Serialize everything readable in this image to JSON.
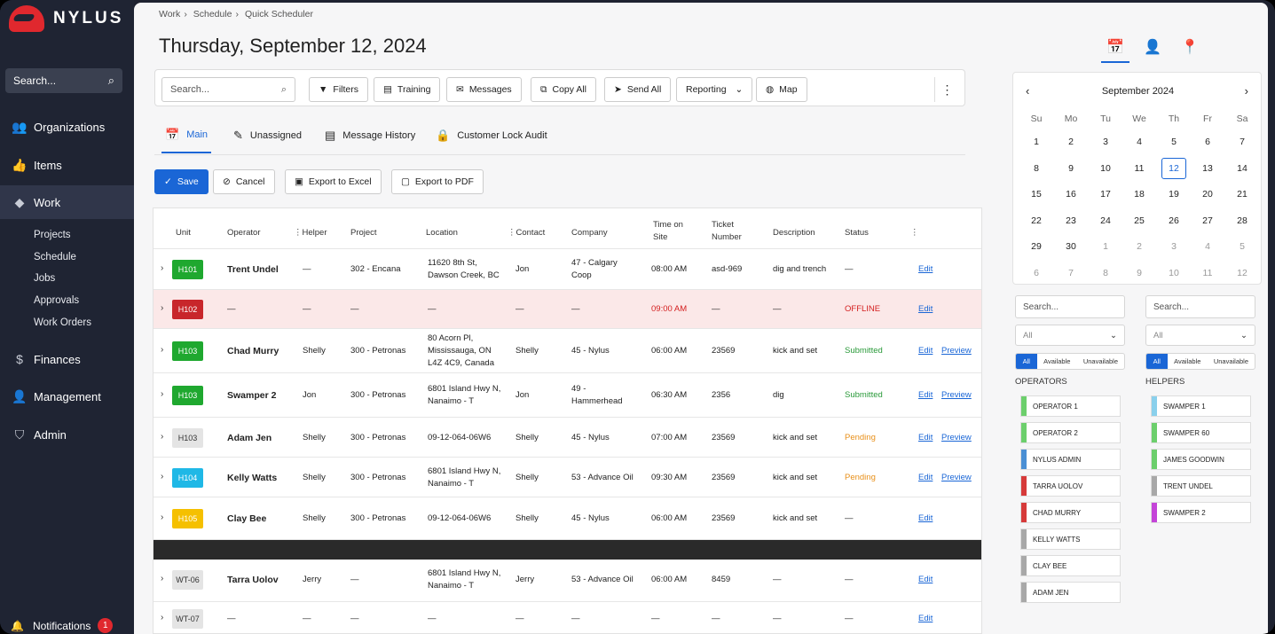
{
  "brand": {
    "name": "NYLUS"
  },
  "sidebar": {
    "search": "Search...",
    "nav": [
      {
        "label": "Organizations",
        "icon": "people-icon"
      },
      {
        "label": "Items",
        "icon": "thumb-icon"
      },
      {
        "label": "Work",
        "icon": "work-icon"
      },
      {
        "label": "Finances",
        "icon": "dollar-icon"
      },
      {
        "label": "Management",
        "icon": "person-icon"
      },
      {
        "label": "Admin",
        "icon": "shield-icon"
      }
    ],
    "sub": [
      "Projects",
      "Schedule",
      "Jobs",
      "Approvals",
      "Work Orders"
    ],
    "notifications": {
      "label": "Notifications",
      "count": "1"
    }
  },
  "breadcrumb": [
    "Work",
    "Schedule",
    "Quick Scheduler"
  ],
  "page_title": "Thursday, September 12, 2024",
  "toolbar": {
    "search": "Search...",
    "buttons": [
      "Filters",
      "Training",
      "Messages",
      "Copy All",
      "Send All",
      "Reporting",
      "Map"
    ]
  },
  "tabs": [
    "Main",
    "Unassigned",
    "Message History",
    "Customer Lock Audit"
  ],
  "actions": [
    "Save",
    "Cancel",
    "Export to Excel",
    "Export to PDF"
  ],
  "table": {
    "headers": {
      "unit": "Unit",
      "operator": "Operator",
      "helper": "Helper",
      "project": "Project",
      "location": "Location",
      "contact": "Contact",
      "company": "Company",
      "time1": "Time on",
      "time2": "Site",
      "ticket1": "Ticket",
      "ticket2": "Number",
      "description": "Description",
      "status": "Status"
    },
    "rows": [
      {
        "unit": "H101",
        "unit_color": "#1fa82f",
        "operator": "Trent Undel",
        "helper": "—",
        "project": "302 - Encana",
        "location": [
          "11620 8th St,",
          "Dawson Creek, BC"
        ],
        "contact": "Jon",
        "company": [
          "47 - Calgary",
          "Coop"
        ],
        "time": "08:00 AM",
        "ticket": "asd-969",
        "description": "dig and trench",
        "status": "—",
        "status_color": "#222",
        "edit": "Edit",
        "preview": ""
      },
      {
        "unit": "H102",
        "unit_color": "#c8262b",
        "operator": "—",
        "helper": "—",
        "project": "—",
        "location": [
          "—"
        ],
        "contact": "—",
        "company": [
          "—"
        ],
        "time": "09:00 AM",
        "ticket": "—",
        "description": "—",
        "status": "OFFLINE",
        "status_color": "#d42020",
        "edit": "Edit",
        "preview": ""
      },
      {
        "unit": "H103",
        "unit_color": "#1fa82f",
        "operator": "Chad Murry",
        "helper": "Shelly",
        "project": "300 - Petronas",
        "location": [
          "80 Acorn Pl,",
          "Mississauga, ON",
          "L4Z 4C9, Canada"
        ],
        "contact": "Shelly",
        "company": [
          "45 - Nylus"
        ],
        "time": "06:00 AM",
        "ticket": "23569",
        "description": "kick and set",
        "status": "Submitted",
        "status_color": "#2a9a3a",
        "edit": "Edit",
        "preview": "Preview"
      },
      {
        "unit": "H103",
        "unit_color": "#1fa82f",
        "operator": "Swamper 2",
        "helper": "Jon",
        "project": "300 - Petronas",
        "location": [
          "6801 Island Hwy N,",
          "Nanaimo - T"
        ],
        "contact": "Jon",
        "company": [
          "49 -",
          "Hammerhead"
        ],
        "time": "06:30 AM",
        "ticket": "2356",
        "description": "dig",
        "status": "Submitted",
        "status_color": "#2a9a3a",
        "edit": "Edit",
        "preview": "Preview"
      },
      {
        "unit": "H103",
        "unit_color": "#e4e4e4",
        "operator": "Adam Jen",
        "helper": "Shelly",
        "project": "300 - Petronas",
        "location": [
          "09-12-064-06W6"
        ],
        "contact": "Shelly",
        "company": [
          "45 - Nylus"
        ],
        "time": "07:00 AM",
        "ticket": "23569",
        "description": "kick and set",
        "status": "Pending",
        "status_color": "#e8901a",
        "edit": "Edit",
        "preview": "Preview"
      },
      {
        "unit": "H104",
        "unit_color": "#1fb8e6",
        "operator": "Kelly Watts",
        "helper": "Shelly",
        "project": "300 - Petronas",
        "location": [
          "6801 Island Hwy N,",
          "Nanaimo - T"
        ],
        "contact": "Shelly",
        "company": [
          "53 - Advance Oil"
        ],
        "time": "09:30 AM",
        "ticket": "23569",
        "description": "kick and set",
        "status": "Pending",
        "status_color": "#e8901a",
        "edit": "Edit",
        "preview": "Preview"
      },
      {
        "unit": "H105",
        "unit_color": "#f5c000",
        "operator": "Clay Bee",
        "helper": "Shelly",
        "project": "300 - Petronas",
        "location": [
          "09-12-064-06W6"
        ],
        "contact": "Shelly",
        "company": [
          "45 - Nylus"
        ],
        "time": "06:00 AM",
        "ticket": "23569",
        "description": "kick and set",
        "status": "—",
        "status_color": "#222",
        "edit": "Edit",
        "preview": ""
      },
      {
        "unit": "WT-06",
        "unit_color": "#e4e4e4",
        "operator": "Tarra Uolov",
        "helper": "Jerry",
        "project": "—",
        "location": [
          "6801 Island Hwy N,",
          "Nanaimo - T"
        ],
        "contact": "Jerry",
        "company": [
          "53 - Advance Oil"
        ],
        "time": "06:00 AM",
        "ticket": "8459",
        "description": "—",
        "status": "—",
        "status_color": "#222",
        "edit": "Edit",
        "preview": ""
      },
      {
        "unit": "WT-07",
        "unit_color": "#e4e4e4",
        "operator": "—",
        "helper": "—",
        "project": "—",
        "location": [
          "—"
        ],
        "contact": "—",
        "company": [
          "—"
        ],
        "time": "—",
        "ticket": "—",
        "description": "—",
        "status": "—",
        "status_color": "#222",
        "edit": "Edit",
        "preview": ""
      }
    ]
  },
  "calendar": {
    "month": "September 2024",
    "dow": [
      "Su",
      "Mo",
      "Tu",
      "We",
      "Th",
      "Fr",
      "Sa"
    ],
    "weeks": [
      [
        "1",
        "2",
        "3",
        "4",
        "5",
        "6",
        "7"
      ],
      [
        "8",
        "9",
        "10",
        "11",
        "12",
        "13",
        "14"
      ],
      [
        "15",
        "16",
        "17",
        "18",
        "19",
        "20",
        "21"
      ],
      [
        "22",
        "23",
        "24",
        "25",
        "26",
        "27",
        "28"
      ],
      [
        "29",
        "30",
        "1",
        "2",
        "3",
        "4",
        "5"
      ],
      [
        "6",
        "7",
        "8",
        "9",
        "10",
        "11",
        "12"
      ]
    ],
    "today": "12"
  },
  "operators": {
    "search": "Search...",
    "filter": "All",
    "segments": [
      "All",
      "Available",
      "Unavailable"
    ],
    "label": "OPERATORS",
    "items": [
      {
        "name": "OPERATOR 1",
        "color": "#6ccf6c"
      },
      {
        "name": "OPERATOR 2",
        "color": "#6ccf6c"
      },
      {
        "name": "NYLUS ADMIN",
        "color": "#4a8fd4"
      },
      {
        "name": "TARRA UOLOV",
        "color": "#d63a3a"
      },
      {
        "name": "CHAD MURRY",
        "color": "#d63a3a"
      },
      {
        "name": "KELLY WATTS",
        "color": "#a8a8a8"
      },
      {
        "name": "CLAY BEE",
        "color": "#a8a8a8"
      },
      {
        "name": "ADAM JEN",
        "color": "#a8a8a8"
      }
    ]
  },
  "helpers": {
    "search": "Search...",
    "filter": "All",
    "segments": [
      "All",
      "Available",
      "Unavailable"
    ],
    "label": "HELPERS",
    "items": [
      {
        "name": "SWAMPER 1",
        "color": "#8ad0ec"
      },
      {
        "name": "SWAMPER 60",
        "color": "#6ccf6c"
      },
      {
        "name": "JAMES GOODWIN",
        "color": "#6ccf6c"
      },
      {
        "name": "TRENT UNDEL",
        "color": "#a8a8a8"
      },
      {
        "name": "SWAMPER 2",
        "color": "#c444d8"
      }
    ]
  }
}
